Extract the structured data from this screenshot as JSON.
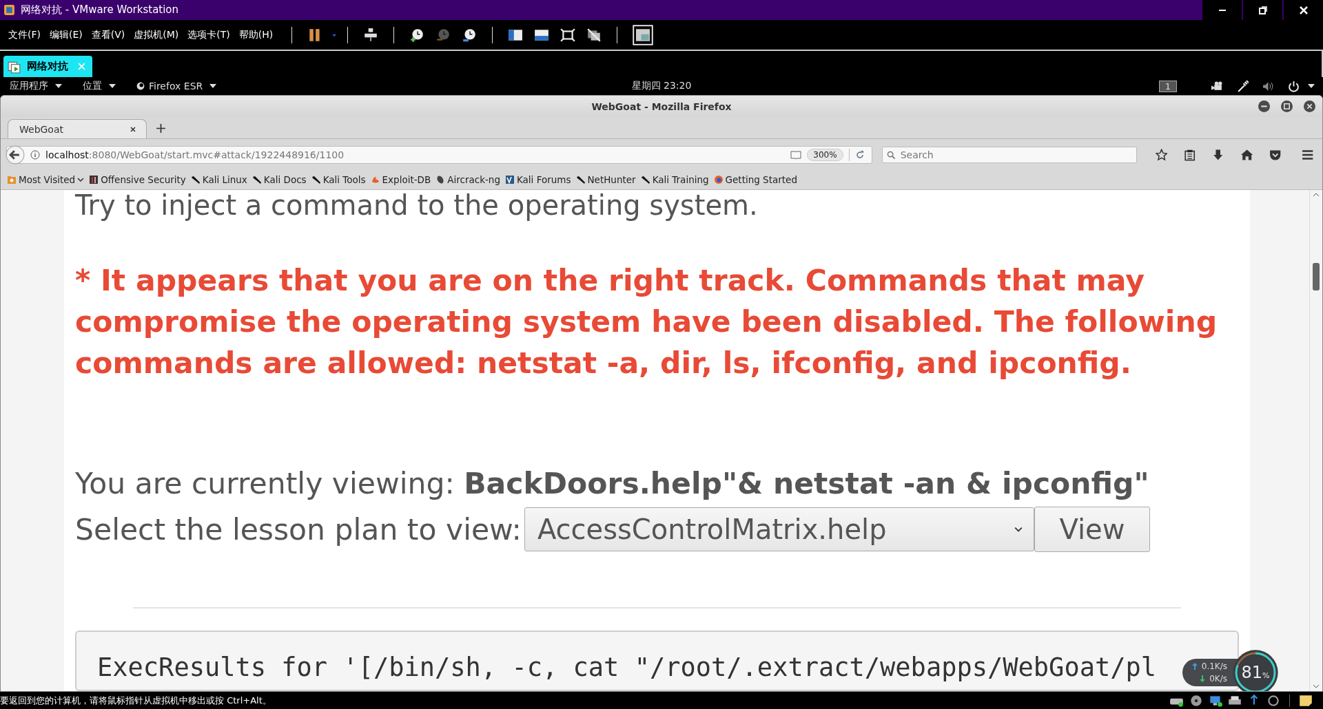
{
  "vmware": {
    "title": "网络对抗 - VMware Workstation",
    "menu": [
      "文件(F)",
      "编辑(E)",
      "查看(V)",
      "虚拟机(M)",
      "选项卡(T)",
      "帮助(H)"
    ],
    "vm_tabs": [
      {
        "label": "网络对抗",
        "selected": true
      }
    ]
  },
  "gnome_bar": {
    "menus": [
      "应用程序",
      "位置",
      "Firefox ESR"
    ],
    "clock": "星期四 23:20",
    "workspace": "1"
  },
  "firefox": {
    "title": "WebGoat - Mozilla Firefox",
    "tabs": [
      {
        "label": "WebGoat",
        "selected": true
      }
    ],
    "url_host": "localhost",
    "url_rest": ":8080/WebGoat/start.mvc#attack/1922448916/1100",
    "zoom": "300%",
    "search": {
      "placeholder": "Search"
    },
    "bookmarks": [
      {
        "label": "Most Visited",
        "kind": "folder"
      },
      {
        "label": "Offensive Security",
        "kind": "tile"
      },
      {
        "label": "Kali Linux",
        "kind": "dragon"
      },
      {
        "label": "Kali Docs",
        "kind": "dragon"
      },
      {
        "label": "Kali Tools",
        "kind": "dragon"
      },
      {
        "label": "Exploit-DB",
        "kind": "flame"
      },
      {
        "label": "Aircrack-ng",
        "kind": "disc"
      },
      {
        "label": "Kali Forums",
        "kind": "square"
      },
      {
        "label": "NetHunter",
        "kind": "dragon"
      },
      {
        "label": "Kali Training",
        "kind": "dragon"
      },
      {
        "label": "Getting Started",
        "kind": "globe"
      }
    ]
  },
  "page": {
    "intro": "Try to inject a command to the operating system.",
    "warning": "* It appears that you are on the right track. Commands that may compromise the operating system have been disabled. The following commands are allowed: netstat -a, dir, ls, ifconfig, and ipconfig.",
    "viewing": "You are currently viewing: **BackDoors.help\"& netstat -an & ipconfig\"**",
    "select_label": "Select the lesson plan to view:",
    "select_value": "AccessControlMatrix.help",
    "view_button": "View",
    "exec_result": "ExecResults for '[/bin/sh, -c, cat \"/root/.extract/webapps/WebGoat/pl"
  },
  "net_monitor": {
    "upload": "0.1K/s",
    "download": "0K/s",
    "cpu": "81",
    "cpu_unit": "%",
    "level": 0.81
  },
  "status_bar": {
    "message": "要返回到您的计算机，请将鼠标指针从虚拟机中移出或按 Ctrl+Alt。"
  }
}
